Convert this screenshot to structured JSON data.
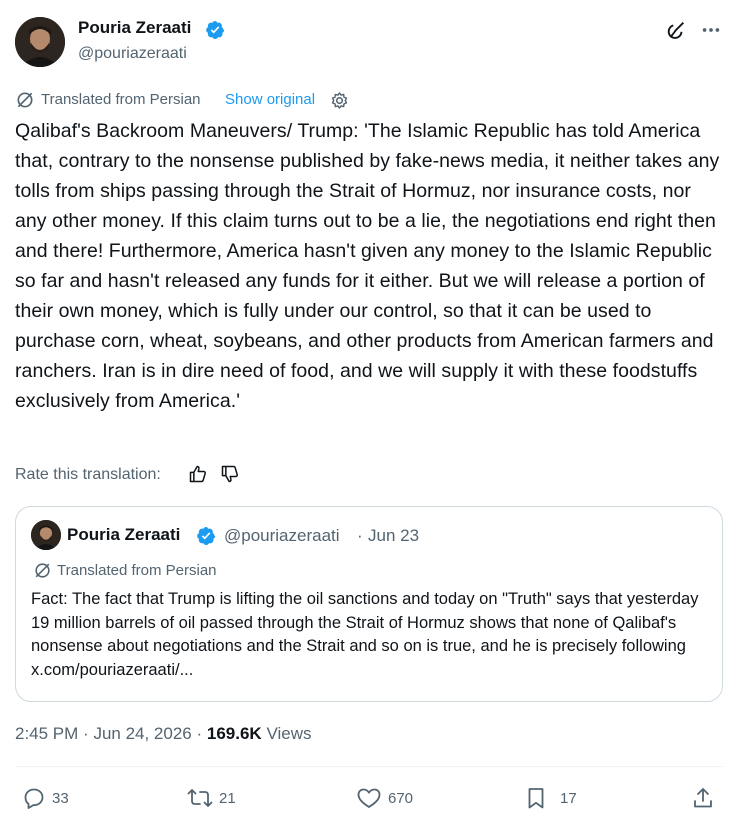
{
  "author": {
    "name": "Pouria Zeraati",
    "handle": "@pouriazeraati",
    "verified": true,
    "avatar": "avatar-photo"
  },
  "header_icons": [
    "grok-icon",
    "more-icon"
  ],
  "translation": {
    "label": "Translated from Persian",
    "show_original": "Show original",
    "settings_icon": "gear-icon",
    "rate_label": "Rate this translation:"
  },
  "tweet": {
    "text": "Qalibaf's Backroom Maneuvers/ Trump: 'The Islamic Republic has told America that, contrary to the nonsense published by fake-news media, it neither takes any tolls from ships passing through the Strait of Hormuz, nor insurance costs, nor any other money. If this claim turns out to be a lie, the negotiations end right then and there! Furthermore, America hasn't given any money to the Islamic Republic so far and hasn't released any funds for it either. But we will release a portion of their own money, which is fully under our control, so that it can be used to purchase corn, wheat, soybeans, and other products from American farmers and ranchers. Iran is in dire need of food, and we will supply it with these foodstuffs exclusively from America.'",
    "time": "2:45 PM",
    "date": "Jun 24, 2026",
    "views_count": "169.6K",
    "views_label": "Views"
  },
  "quote": {
    "name": "Pouria Zeraati",
    "handle": "@pouriazeraati",
    "date": "Jun 23",
    "translated_label": "Translated from Persian",
    "text": "Fact: The fact that Trump is lifting the oil sanctions and today on \"Truth\" says that yesterday 19 million barrels of oil passed through the Strait of Hormuz shows that none of Qalibaf's nonsense about negotiations and the Strait and so on is true, and he is precisely following x.com/pouriazeraati/..."
  },
  "actions": {
    "replies": "33",
    "reposts": "21",
    "likes": "670",
    "bookmarks": "17"
  },
  "colors": {
    "text": "#0f1419",
    "secondary": "#536471",
    "accent": "#1d9bf0",
    "border": "#cfd9de"
  }
}
